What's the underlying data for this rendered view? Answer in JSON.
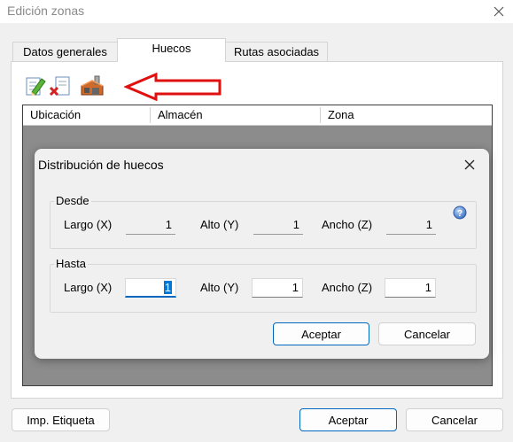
{
  "window": {
    "title": "Edición zonas"
  },
  "tabs": [
    {
      "label": "Datos generales"
    },
    {
      "label": "Huecos"
    },
    {
      "label": "Rutas asociadas"
    }
  ],
  "grid": {
    "columns": [
      "Ubicación",
      "Almacén",
      "Zona"
    ]
  },
  "dialog": {
    "title": "Distribución de huecos",
    "desde": {
      "label": "Desde",
      "largo_label": "Largo (X)",
      "largo": "1",
      "alto_label": "Alto (Y)",
      "alto": "1",
      "ancho_label": "Ancho (Z)",
      "ancho": "1"
    },
    "hasta": {
      "label": "Hasta",
      "largo_label": "Largo (X)",
      "largo": "1",
      "alto_label": "Alto (Y)",
      "alto": "1",
      "ancho_label": "Ancho (Z)",
      "ancho": "1"
    },
    "accept": "Aceptar",
    "cancel": "Cancelar"
  },
  "footer": {
    "print_label": "Imp. Etiqueta",
    "accept": "Aceptar",
    "cancel": "Cancelar"
  },
  "colors": {
    "arrow": "#e01010",
    "focus": "#0067c0",
    "grid_bg": "#8c8c8c"
  },
  "icons": [
    "edit-icon",
    "delete-icon",
    "warehouse-distribution-icon",
    "help-icon",
    "close-icon"
  ]
}
